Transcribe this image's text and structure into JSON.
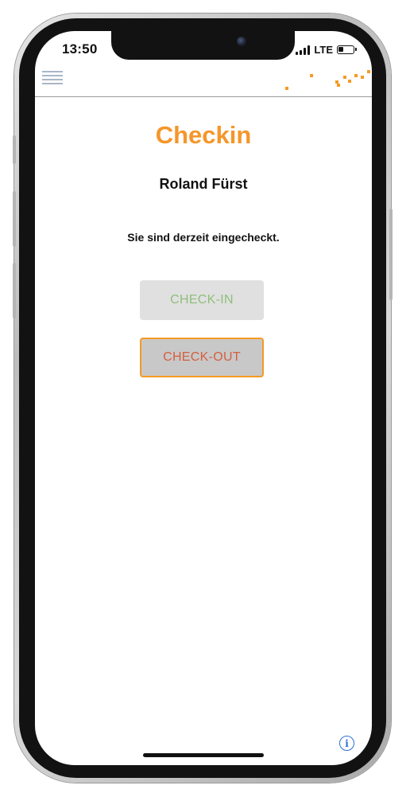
{
  "status_bar": {
    "time": "13:50",
    "network": "LTE"
  },
  "header": {
    "menu_icon": "hamburger-menu-icon",
    "logo": "orange-dots-logo"
  },
  "page": {
    "title": "Checkin",
    "user_name": "Roland Fürst",
    "status_message": "Sie sind derzeit eingecheckt."
  },
  "buttons": {
    "checkin_label": "CHECK-IN",
    "checkout_label": "CHECK-OUT"
  },
  "footer": {
    "info_icon": "info-icon",
    "info_glyph": "i"
  },
  "colors": {
    "accent": "#f5962a",
    "checkin_text": "#8fbf7c",
    "checkout_text": "#d45f3f",
    "info": "#2a6fd6"
  }
}
